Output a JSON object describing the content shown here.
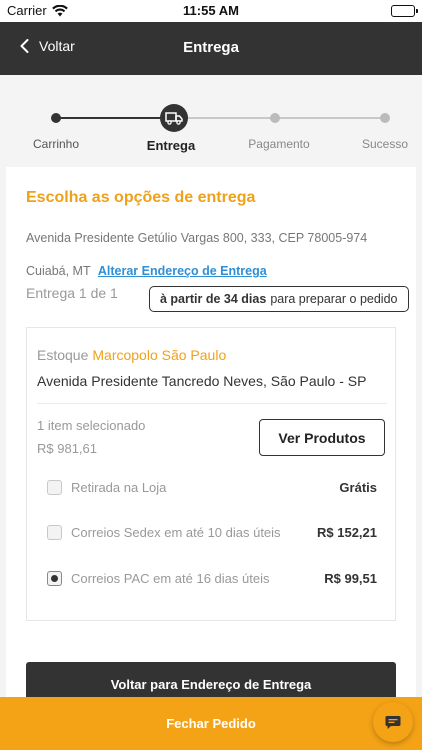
{
  "status_bar": {
    "carrier": "Carrier",
    "time": "11:55 AM"
  },
  "nav": {
    "back_label": "Voltar",
    "title": "Entrega"
  },
  "stepper": {
    "steps": [
      {
        "label": "Carrinho",
        "state": "done"
      },
      {
        "label": "Entrega",
        "state": "active",
        "icon": "truck-icon"
      },
      {
        "label": "Pagamento",
        "state": "todo"
      },
      {
        "label": "Sucesso",
        "state": "todo"
      }
    ]
  },
  "delivery": {
    "heading": "Escolha as opções de entrega",
    "address_text": "Avenida Presidente Getúlio Vargas 800, 333, CEP 78005-974 Cuiabá, MT",
    "change_address_link": "Alterar Endereço de Entrega",
    "entrega_count": "Entrega 1 de 1",
    "prep_bold": "à partir de 34 dias",
    "prep_rest": "para preparar o pedido"
  },
  "stock": {
    "prefix": "Estoque",
    "name": "Marcopolo São Paulo",
    "address": "Avenida Presidente Tancredo Neves, São Paulo - SP",
    "items_selected": "1 item selecionado",
    "items_price": "R$ 981,61",
    "view_products_label": "Ver Produtos",
    "options": [
      {
        "label": "Retirada na Loja",
        "price": "Grátis",
        "selected": false
      },
      {
        "label": "Correios Sedex em até 10 dias úteis",
        "price": "R$ 152,21",
        "selected": false
      },
      {
        "label": "Correios PAC em até 16 dias úteis",
        "price": "R$ 99,51",
        "selected": true
      }
    ]
  },
  "back_to_address_label": "Voltar para Endereço de Entrega",
  "footer": {
    "close_order_label": "Fechar Pedido",
    "chat_icon": "chat-icon"
  },
  "colors": {
    "accent": "#f5a316",
    "heading_orange": "#f0a11a",
    "dark": "#333333",
    "link_blue": "#2f8fd6"
  }
}
